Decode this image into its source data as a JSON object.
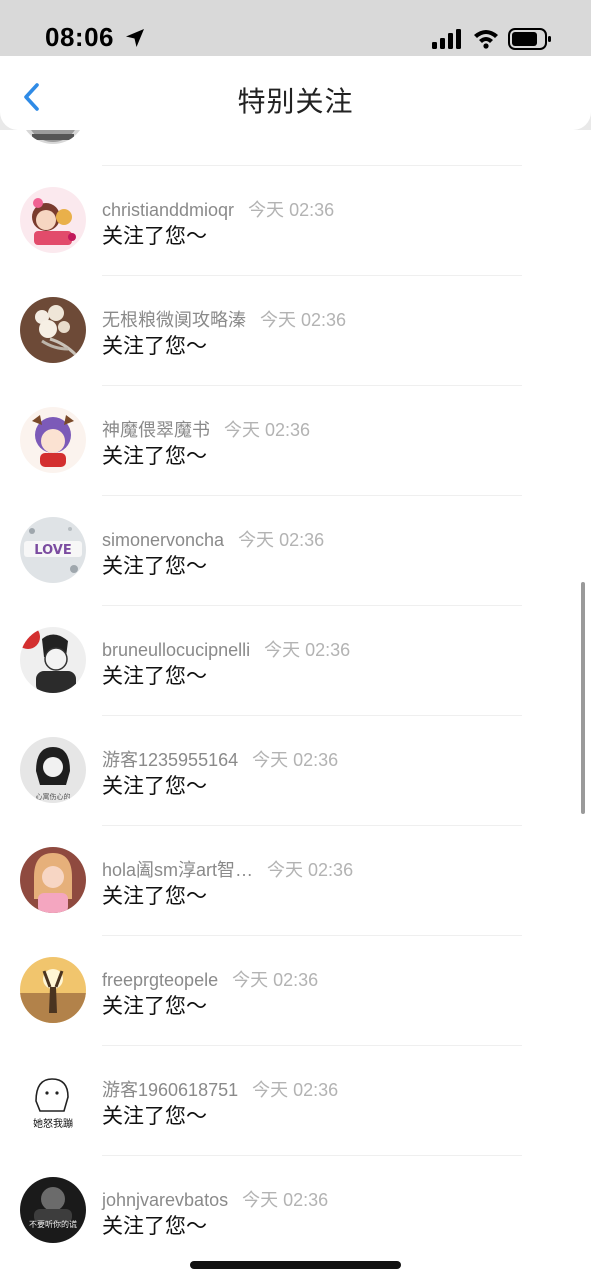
{
  "status_bar": {
    "time": "08:06"
  },
  "header": {
    "title": "特别关注"
  },
  "items": [
    {
      "username": "christianddmioqr",
      "timestamp": "今天 02:36",
      "message": "关注了您～"
    },
    {
      "username": "无根粮微阒攻略溱",
      "timestamp": "今天 02:36",
      "message": "关注了您～"
    },
    {
      "username": "神魔偎翠魔书",
      "timestamp": "今天 02:36",
      "message": "关注了您～"
    },
    {
      "username": "simonervoncha",
      "timestamp": "今天 02:36",
      "message": "关注了您～"
    },
    {
      "username": "bruneullocucipnelli",
      "timestamp": "今天 02:36",
      "message": "关注了您～"
    },
    {
      "username": "游客1235955164",
      "timestamp": "今天 02:36",
      "message": "关注了您～"
    },
    {
      "username": "hola阖sm淳art智…",
      "timestamp": "今天 02:36",
      "message": "关注了您～"
    },
    {
      "username": "freeprgteopele",
      "timestamp": "今天 02:36",
      "message": "关注了您～"
    },
    {
      "username": "游客1960618751",
      "timestamp": "今天 02:36",
      "message": "关注了您～"
    },
    {
      "username": "johnjvarevbatos",
      "timestamp": "今天 02:36",
      "message": "关注了您～"
    }
  ],
  "avatar_text": {
    "love": "LOVE",
    "guest1": "心寓伤心的",
    "guest2": "她怒我蹦",
    "john": "不要听你的谎"
  },
  "colors": {
    "accent": "#2f8be6",
    "username": "#8a8a8a",
    "timestamp": "#b3b3b3"
  }
}
